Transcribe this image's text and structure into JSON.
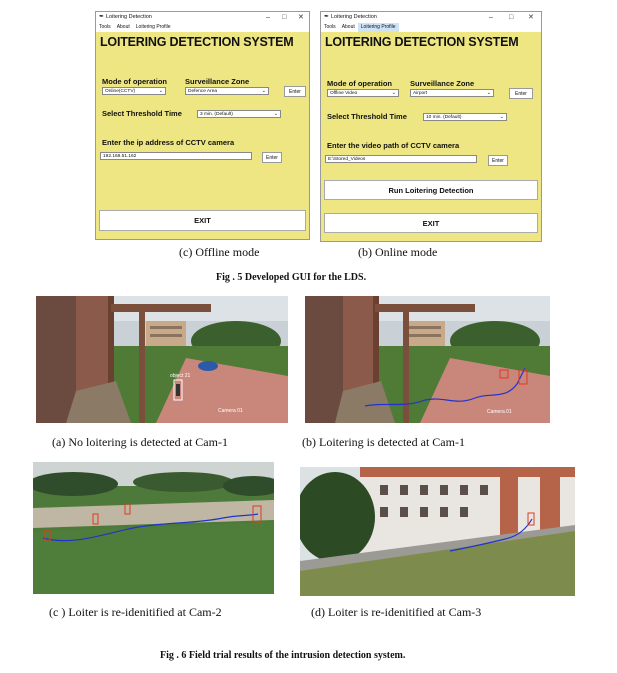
{
  "gui_left": {
    "window_title": "Loitering Detection",
    "menu": [
      "Tools",
      "About",
      "Loitering Profile"
    ],
    "active_menu_index": -1,
    "heading": "LOITERING DETECTION SYSTEM",
    "mode_label": "Mode of operation",
    "mode_value": "Online(CCTV)",
    "zone_label": "Surveillance Zone",
    "zone_value": "Defence Area",
    "enter_label": "Enter",
    "threshold_label": "Select Threshold Time",
    "threshold_value": "3 min. (Default)",
    "path_label": "Enter the ip address of CCTV camera",
    "path_value": "192.168.51.162",
    "path_enter_label": "Enter",
    "exit_label": "EXIT"
  },
  "gui_right": {
    "window_title": "Loitering Detection",
    "menu": [
      "Tools",
      "About",
      "Loitering Profile"
    ],
    "active_menu_index": 2,
    "heading": "LOITERING DETECTION SYSTEM",
    "mode_label": "Mode of operation",
    "mode_value": "Offline Video",
    "zone_label": "Surveillance Zone",
    "zone_value": "Airport",
    "enter_label": "Enter",
    "threshold_label": "Select Threshold Time",
    "threshold_value": "10 min. (Default)",
    "path_label": "Enter the video path of CCTV camera",
    "path_value": "E:\\Stored_Videos",
    "path_enter_label": "Enter",
    "run_label": "Run Loitering Detection",
    "exit_label": "EXIT"
  },
  "captions": {
    "fig5_left": "(c)  Offline mode",
    "fig5_right": "(b) Online mode",
    "fig5": "Fig . 5  Developed GUI for the LDS.",
    "fig6_a": "(a)  No loitering is detected at Cam-1",
    "fig6_b": "(b) Loitering is detected at Cam-1",
    "fig6_c": "(c ) Loiter is re-idenitified at Cam-2",
    "fig6_d": "(d) Loiter is re-idenitified at Cam-3",
    "fig6": "Fig . 6  Field trial results of the intrusion detection system."
  },
  "photo_labels": {
    "object_tag": "object 21",
    "camera_tag": "Camera 01"
  },
  "colors": {
    "gui_bg": "#ede682",
    "track_blue": "#2233cc",
    "box_white": "#ffffff",
    "box_red": "#e23a1e"
  }
}
